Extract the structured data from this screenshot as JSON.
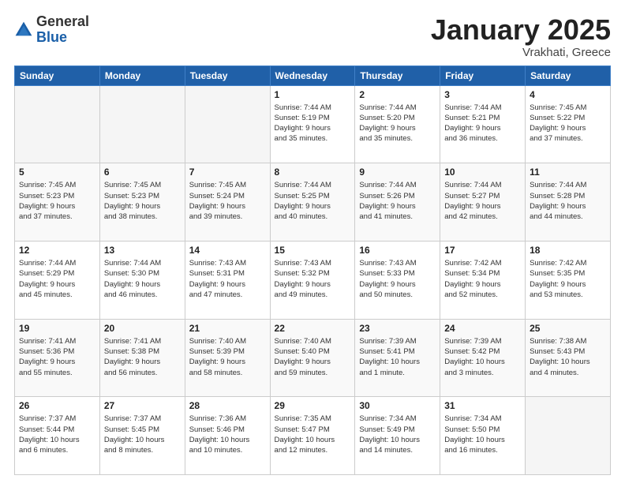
{
  "header": {
    "logo_general": "General",
    "logo_blue": "Blue",
    "title": "January 2025",
    "location": "Vrakhati, Greece"
  },
  "days_of_week": [
    "Sunday",
    "Monday",
    "Tuesday",
    "Wednesday",
    "Thursday",
    "Friday",
    "Saturday"
  ],
  "weeks": [
    {
      "days": [
        {
          "num": "",
          "info": ""
        },
        {
          "num": "",
          "info": ""
        },
        {
          "num": "",
          "info": ""
        },
        {
          "num": "1",
          "info": "Sunrise: 7:44 AM\nSunset: 5:19 PM\nDaylight: 9 hours\nand 35 minutes."
        },
        {
          "num": "2",
          "info": "Sunrise: 7:44 AM\nSunset: 5:20 PM\nDaylight: 9 hours\nand 35 minutes."
        },
        {
          "num": "3",
          "info": "Sunrise: 7:44 AM\nSunset: 5:21 PM\nDaylight: 9 hours\nand 36 minutes."
        },
        {
          "num": "4",
          "info": "Sunrise: 7:45 AM\nSunset: 5:22 PM\nDaylight: 9 hours\nand 37 minutes."
        }
      ]
    },
    {
      "days": [
        {
          "num": "5",
          "info": "Sunrise: 7:45 AM\nSunset: 5:23 PM\nDaylight: 9 hours\nand 37 minutes."
        },
        {
          "num": "6",
          "info": "Sunrise: 7:45 AM\nSunset: 5:23 PM\nDaylight: 9 hours\nand 38 minutes."
        },
        {
          "num": "7",
          "info": "Sunrise: 7:45 AM\nSunset: 5:24 PM\nDaylight: 9 hours\nand 39 minutes."
        },
        {
          "num": "8",
          "info": "Sunrise: 7:44 AM\nSunset: 5:25 PM\nDaylight: 9 hours\nand 40 minutes."
        },
        {
          "num": "9",
          "info": "Sunrise: 7:44 AM\nSunset: 5:26 PM\nDaylight: 9 hours\nand 41 minutes."
        },
        {
          "num": "10",
          "info": "Sunrise: 7:44 AM\nSunset: 5:27 PM\nDaylight: 9 hours\nand 42 minutes."
        },
        {
          "num": "11",
          "info": "Sunrise: 7:44 AM\nSunset: 5:28 PM\nDaylight: 9 hours\nand 44 minutes."
        }
      ]
    },
    {
      "days": [
        {
          "num": "12",
          "info": "Sunrise: 7:44 AM\nSunset: 5:29 PM\nDaylight: 9 hours\nand 45 minutes."
        },
        {
          "num": "13",
          "info": "Sunrise: 7:44 AM\nSunset: 5:30 PM\nDaylight: 9 hours\nand 46 minutes."
        },
        {
          "num": "14",
          "info": "Sunrise: 7:43 AM\nSunset: 5:31 PM\nDaylight: 9 hours\nand 47 minutes."
        },
        {
          "num": "15",
          "info": "Sunrise: 7:43 AM\nSunset: 5:32 PM\nDaylight: 9 hours\nand 49 minutes."
        },
        {
          "num": "16",
          "info": "Sunrise: 7:43 AM\nSunset: 5:33 PM\nDaylight: 9 hours\nand 50 minutes."
        },
        {
          "num": "17",
          "info": "Sunrise: 7:42 AM\nSunset: 5:34 PM\nDaylight: 9 hours\nand 52 minutes."
        },
        {
          "num": "18",
          "info": "Sunrise: 7:42 AM\nSunset: 5:35 PM\nDaylight: 9 hours\nand 53 minutes."
        }
      ]
    },
    {
      "days": [
        {
          "num": "19",
          "info": "Sunrise: 7:41 AM\nSunset: 5:36 PM\nDaylight: 9 hours\nand 55 minutes."
        },
        {
          "num": "20",
          "info": "Sunrise: 7:41 AM\nSunset: 5:38 PM\nDaylight: 9 hours\nand 56 minutes."
        },
        {
          "num": "21",
          "info": "Sunrise: 7:40 AM\nSunset: 5:39 PM\nDaylight: 9 hours\nand 58 minutes."
        },
        {
          "num": "22",
          "info": "Sunrise: 7:40 AM\nSunset: 5:40 PM\nDaylight: 9 hours\nand 59 minutes."
        },
        {
          "num": "23",
          "info": "Sunrise: 7:39 AM\nSunset: 5:41 PM\nDaylight: 10 hours\nand 1 minute."
        },
        {
          "num": "24",
          "info": "Sunrise: 7:39 AM\nSunset: 5:42 PM\nDaylight: 10 hours\nand 3 minutes."
        },
        {
          "num": "25",
          "info": "Sunrise: 7:38 AM\nSunset: 5:43 PM\nDaylight: 10 hours\nand 4 minutes."
        }
      ]
    },
    {
      "days": [
        {
          "num": "26",
          "info": "Sunrise: 7:37 AM\nSunset: 5:44 PM\nDaylight: 10 hours\nand 6 minutes."
        },
        {
          "num": "27",
          "info": "Sunrise: 7:37 AM\nSunset: 5:45 PM\nDaylight: 10 hours\nand 8 minutes."
        },
        {
          "num": "28",
          "info": "Sunrise: 7:36 AM\nSunset: 5:46 PM\nDaylight: 10 hours\nand 10 minutes."
        },
        {
          "num": "29",
          "info": "Sunrise: 7:35 AM\nSunset: 5:47 PM\nDaylight: 10 hours\nand 12 minutes."
        },
        {
          "num": "30",
          "info": "Sunrise: 7:34 AM\nSunset: 5:49 PM\nDaylight: 10 hours\nand 14 minutes."
        },
        {
          "num": "31",
          "info": "Sunrise: 7:34 AM\nSunset: 5:50 PM\nDaylight: 10 hours\nand 16 minutes."
        },
        {
          "num": "",
          "info": ""
        }
      ]
    }
  ]
}
